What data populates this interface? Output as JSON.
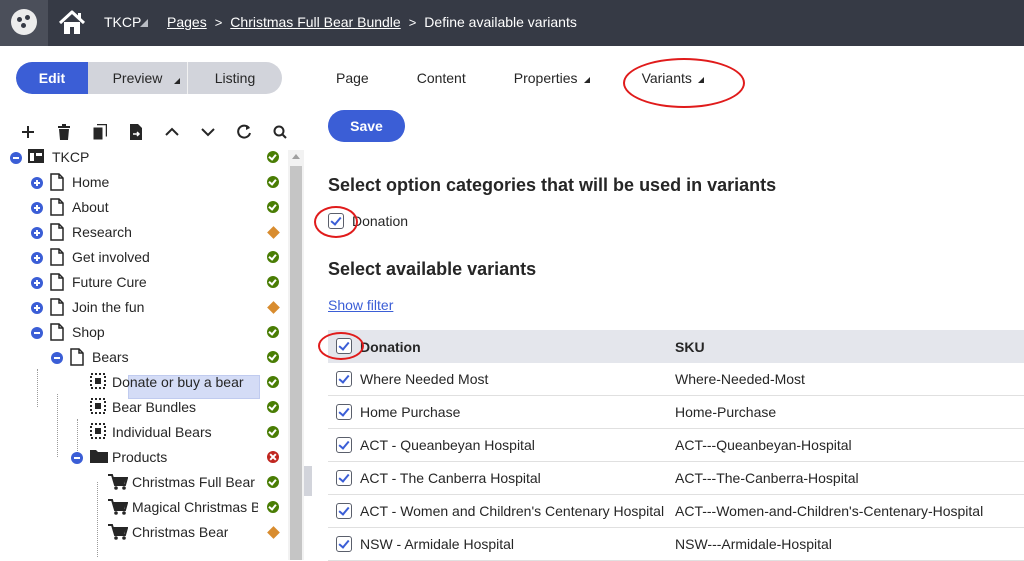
{
  "header": {
    "site_name": "TKCP",
    "breadcrumbs": [
      "Pages",
      "Christmas Full Bear Bundle",
      "Define available variants"
    ]
  },
  "modes": {
    "edit": "Edit",
    "preview": "Preview",
    "listing": "Listing"
  },
  "tabs": [
    "Page",
    "Content",
    "Properties",
    "Variants"
  ],
  "tree": {
    "nodes": [
      {
        "label": "TKCP",
        "status": "ok"
      },
      {
        "label": "Home",
        "status": "ok"
      },
      {
        "label": "About",
        "status": "ok"
      },
      {
        "label": "Research",
        "status": "warn"
      },
      {
        "label": "Get involved",
        "status": "ok"
      },
      {
        "label": "Future Cure",
        "status": "ok"
      },
      {
        "label": "Join the fun",
        "status": "warn"
      },
      {
        "label": "Shop",
        "status": "ok"
      },
      {
        "label": "Bears",
        "status": "ok"
      },
      {
        "label": "Donate or buy a bear",
        "status": "ok"
      },
      {
        "label": "Bear Bundles",
        "status": "ok"
      },
      {
        "label": "Individual Bears",
        "status": "ok"
      },
      {
        "label": "Products",
        "status": "err"
      },
      {
        "label": "Christmas Full Bear Bundle",
        "status": "ok"
      },
      {
        "label": "Magical Christmas Bear",
        "status": "ok"
      },
      {
        "label": "Christmas Bear",
        "status": "warn"
      }
    ]
  },
  "main": {
    "save_label": "Save",
    "option_heading": "Select option categories that will be used in variants",
    "option_category": "Donation",
    "variants_heading": "Select available variants",
    "show_filter": "Show filter",
    "columns": [
      "Donation",
      "SKU"
    ],
    "rows": [
      {
        "donation": "Where Needed Most",
        "sku": "Where-Needed-Most"
      },
      {
        "donation": "Home Purchase",
        "sku": "Home-Purchase"
      },
      {
        "donation": "ACT - Queanbeyan Hospital",
        "sku": "ACT---Queanbeyan-Hospital"
      },
      {
        "donation": "ACT - The Canberra Hospital",
        "sku": "ACT---The-Canberra-Hospital"
      },
      {
        "donation": "ACT - Women and Children's Centenary Hospital",
        "sku": "ACT---Women-and-Children's-Centenary-Hospital"
      },
      {
        "donation": "NSW - Armidale Hospital",
        "sku": "NSW---Armidale-Hospital"
      }
    ]
  },
  "colors": {
    "accent": "#3b5ed6",
    "header_bg": "#363a45",
    "annotation": "#e01b1b"
  }
}
